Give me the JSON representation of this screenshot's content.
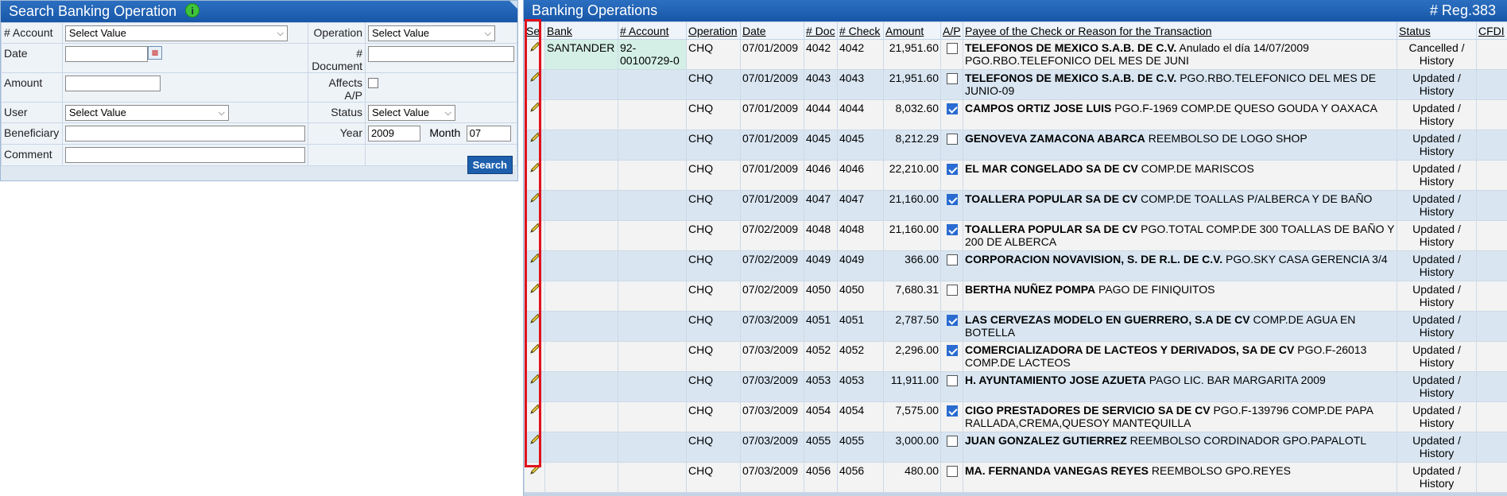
{
  "search": {
    "title": "Search Banking Operation",
    "info_icon_glyph": "i",
    "labels": {
      "account": "# Account",
      "operation": "Operation",
      "date": "Date",
      "document": "# Document",
      "amount": "Amount",
      "affects_ap": "Affects A/P",
      "user": "User",
      "status": "Status",
      "beneficiary": "Beneficiary",
      "year": "Year",
      "month": "Month",
      "comment": "Comment"
    },
    "values": {
      "account": "Select Value",
      "operation": "Select Value",
      "user": "Select Value",
      "status": "Select Value",
      "year": "2009",
      "month": "07"
    },
    "search_button": "Search"
  },
  "ops": {
    "title": "Banking Operations",
    "reg_count": "# Reg.383",
    "columns": [
      "Se",
      "Bank",
      "# Account",
      "Operation",
      "Date",
      "# Doc",
      "# Check",
      "Amount",
      "A/P",
      "Payee of the Check or Reason for the Transaction",
      "Status",
      "CFDI"
    ],
    "rows": [
      {
        "bank": "SANTANDER",
        "account": "92-00100729-0",
        "op": "CHQ",
        "date": "07/01/2009",
        "doc": "4042",
        "check": "4042",
        "amount": "21,951.60",
        "ap": false,
        "payee": "TELEFONOS DE MEXICO S.A.B. DE C.V.",
        "reason": "Anulado el día 14/07/2009 PGO.RBO.TELEFONICO DEL MES DE JUNI",
        "status": "Cancelled / History"
      },
      {
        "bank": "",
        "account": "",
        "op": "CHQ",
        "date": "07/01/2009",
        "doc": "4043",
        "check": "4043",
        "amount": "21,951.60",
        "ap": false,
        "payee": "TELEFONOS DE MEXICO S.A.B. DE C.V.",
        "reason": "PGO.RBO.TELEFONICO DEL MES DE JUNIO-09",
        "status": "Updated / History"
      },
      {
        "bank": "",
        "account": "",
        "op": "CHQ",
        "date": "07/01/2009",
        "doc": "4044",
        "check": "4044",
        "amount": "8,032.60",
        "ap": true,
        "payee": "CAMPOS ORTIZ JOSE LUIS",
        "reason": "PGO.F-1969 COMP.DE QUESO GOUDA Y OAXACA",
        "status": "Updated / History"
      },
      {
        "bank": "",
        "account": "",
        "op": "CHQ",
        "date": "07/01/2009",
        "doc": "4045",
        "check": "4045",
        "amount": "8,212.29",
        "ap": false,
        "payee": "GENOVEVA ZAMACONA ABARCA",
        "reason": "REEMBOLSO DE LOGO SHOP",
        "status": "Updated / History"
      },
      {
        "bank": "",
        "account": "",
        "op": "CHQ",
        "date": "07/01/2009",
        "doc": "4046",
        "check": "4046",
        "amount": "22,210.00",
        "ap": true,
        "payee": "EL MAR CONGELADO SA DE CV",
        "reason": "COMP.DE MARISCOS",
        "status": "Updated / History"
      },
      {
        "bank": "",
        "account": "",
        "op": "CHQ",
        "date": "07/01/2009",
        "doc": "4047",
        "check": "4047",
        "amount": "21,160.00",
        "ap": true,
        "payee": "TOALLERA POPULAR SA DE CV",
        "reason": "COMP.DE TOALLAS P/ALBERCA Y DE BAÑO",
        "status": "Updated / History"
      },
      {
        "bank": "",
        "account": "",
        "op": "CHQ",
        "date": "07/02/2009",
        "doc": "4048",
        "check": "4048",
        "amount": "21,160.00",
        "ap": true,
        "payee": "TOALLERA POPULAR SA DE CV",
        "reason": "PGO.TOTAL COMP.DE 300 TOALLAS DE BAÑO Y 200 DE ALBERCA",
        "status": "Updated / History"
      },
      {
        "bank": "",
        "account": "",
        "op": "CHQ",
        "date": "07/02/2009",
        "doc": "4049",
        "check": "4049",
        "amount": "366.00",
        "ap": false,
        "payee": "CORPORACION NOVAVISION, S. DE R.L. DE C.V.",
        "reason": "PGO.SKY CASA GERENCIA 3/4",
        "status": "Updated / History"
      },
      {
        "bank": "",
        "account": "",
        "op": "CHQ",
        "date": "07/02/2009",
        "doc": "4050",
        "check": "4050",
        "amount": "7,680.31",
        "ap": false,
        "payee": "BERTHA NUÑEZ POMPA",
        "reason": "PAGO DE FINIQUITOS",
        "status": "Updated / History"
      },
      {
        "bank": "",
        "account": "",
        "op": "CHQ",
        "date": "07/03/2009",
        "doc": "4051",
        "check": "4051",
        "amount": "2,787.50",
        "ap": true,
        "payee": "LAS CERVEZAS MODELO EN GUERRERO, S.A DE CV",
        "reason": "COMP.DE AGUA EN BOTELLA",
        "status": "Updated / History"
      },
      {
        "bank": "",
        "account": "",
        "op": "CHQ",
        "date": "07/03/2009",
        "doc": "4052",
        "check": "4052",
        "amount": "2,296.00",
        "ap": true,
        "payee": "COMERCIALIZADORA DE LACTEOS Y DERIVADOS, SA DE CV",
        "reason": "PGO.F-26013 COMP.DE LACTEOS",
        "status": "Updated / History"
      },
      {
        "bank": "",
        "account": "",
        "op": "CHQ",
        "date": "07/03/2009",
        "doc": "4053",
        "check": "4053",
        "amount": "11,911.00",
        "ap": false,
        "payee": "H. AYUNTAMIENTO JOSE AZUETA",
        "reason": "PAGO LIC. BAR MARGARITA 2009",
        "status": "Updated / History"
      },
      {
        "bank": "",
        "account": "",
        "op": "CHQ",
        "date": "07/03/2009",
        "doc": "4054",
        "check": "4054",
        "amount": "7,575.00",
        "ap": true,
        "payee": "CIGO PRESTADORES DE SERVICIO SA DE CV",
        "reason": "PGO.F-139796 COMP.DE PAPA RALLADA,CREMA,QUESOY MANTEQUILLA",
        "status": "Updated / History"
      },
      {
        "bank": "",
        "account": "",
        "op": "CHQ",
        "date": "07/03/2009",
        "doc": "4055",
        "check": "4055",
        "amount": "3,000.00",
        "ap": false,
        "payee": "JUAN GONZALEZ GUTIERREZ",
        "reason": "REEMBOLSO CORDINADOR GPO.PAPALOTL",
        "status": "Updated / History"
      },
      {
        "bank": "",
        "account": "",
        "op": "CHQ",
        "date": "07/03/2009",
        "doc": "4056",
        "check": "4056",
        "amount": "480.00",
        "ap": false,
        "payee": "MA. FERNANDA VANEGAS REYES",
        "reason": "REEMBOLSO GPO.REYES",
        "status": "Updated / History"
      }
    ]
  },
  "colors": {
    "header_blue": "#1757a8",
    "row_even": "#d9e6f2",
    "highlight_red": "#e0121b",
    "check_blue": "#2a6bd1"
  },
  "icons": {
    "edit": "pencil-icon",
    "calendar": "calendar-icon",
    "info": "info-icon"
  }
}
